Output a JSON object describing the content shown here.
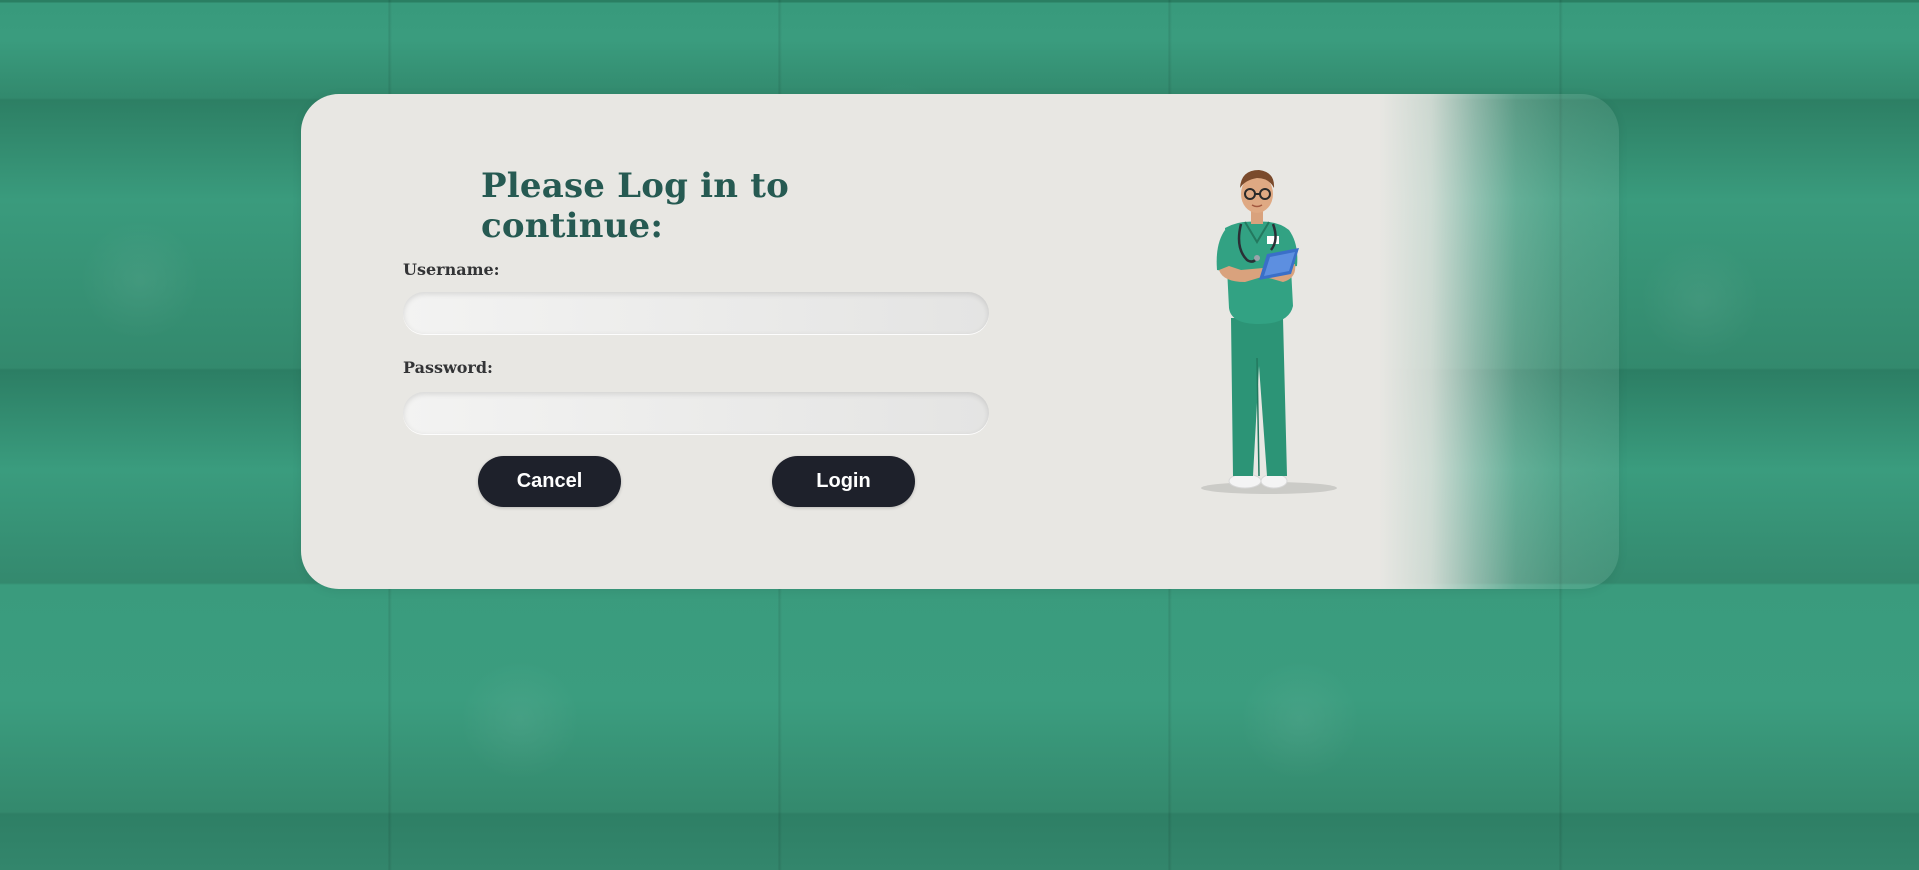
{
  "login_form": {
    "title": "Please Log in to continue:",
    "username_label": "Username:",
    "username_value": "",
    "password_label": "Password:",
    "password_value": "",
    "cancel_label": "Cancel",
    "login_label": "Login"
  },
  "illustration": {
    "icon": "nurse-illustration",
    "description_colors": {
      "scrubs": "#2f9a7d",
      "clipboard": "#3a6fc8",
      "hair": "#7a4a2c"
    }
  },
  "colors": {
    "background": "#2f8a6e",
    "card": "#e8e7e3",
    "title": "#265a52",
    "button": "#1e212b"
  }
}
